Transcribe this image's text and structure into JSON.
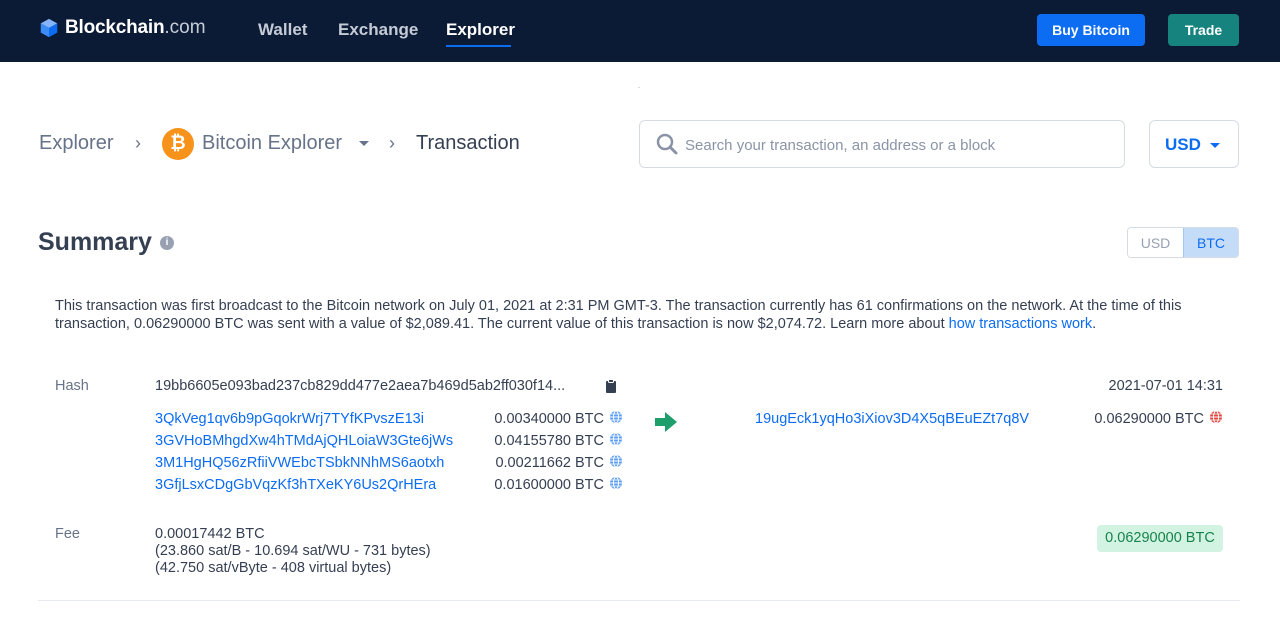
{
  "header": {
    "brand": "Blockchain",
    "brand_domain": ".com",
    "nav": {
      "wallet": "Wallet",
      "exchange": "Exchange",
      "explorer": "Explorer"
    },
    "buy_label": "Buy Bitcoin",
    "trade_label": "Trade"
  },
  "breadcrumb": {
    "root": "Explorer",
    "coin_symbol": "₿",
    "coin": "Bitcoin Explorer",
    "current": "Transaction",
    "separator": "›"
  },
  "search": {
    "placeholder": "Search your transaction, an address or a block"
  },
  "currency": {
    "selected": "USD"
  },
  "summary": {
    "title": "Summary",
    "info_icon": "i",
    "toggle": {
      "usd": "USD",
      "btc": "BTC",
      "active": "BTC"
    },
    "description": "This transaction was first broadcast to the Bitcoin network on July 01, 2021 at 2:31 PM GMT-3.  The transaction currently has 61 confirmations on the network.  At the time of this transaction, 0.06290000 BTC was sent with a value of $2,089.41. The current value of this transaction is now $2,074.72.  Learn more about ",
    "learn_more_link": "how transactions work",
    "period": "."
  },
  "transaction": {
    "hash_label": "Hash",
    "hash": "19bb6605e093bad237cb829dd477e2aea7b469d5ab2ff030f14...",
    "date": "2021-07-01 14:31",
    "inputs": [
      {
        "address": "3QkVeg1qv6b9pGqokrWrj7TYfKPvszE13i",
        "amount": "0.00340000 BTC"
      },
      {
        "address": "3GVHoBMhgdXw4hTMdAjQHLoiaW3Gte6jWs",
        "amount": "0.04155780 BTC"
      },
      {
        "address": "3M1HgHQ56zRfiiVWEbcTSbkNNhMS6aotxh",
        "amount": "0.00211662 BTC"
      },
      {
        "address": "3GfjLsxCDgGbVqzKf3hTXeKY6Us2QrHEra",
        "amount": "0.01600000 BTC"
      }
    ],
    "output": {
      "address": "19ugEck1yqHo3iXiov3D4X5qBEuEZt7q8V",
      "amount": "0.06290000 BTC"
    },
    "fee_label": "Fee",
    "fee": "0.00017442 BTC",
    "fee_detail_1": "(23.860 sat/B - 10.694 sat/WU - 731 bytes)",
    "fee_detail_2": "(42.750 sat/vByte - 408 virtual bytes)",
    "total": "0.06290000 BTC"
  },
  "icons": {
    "logo": "blockchain-cube-icon",
    "search": "search-icon",
    "copy": "clipboard-icon",
    "globe": "globe-icon",
    "arrow": "arrow-right-icon"
  },
  "colors": {
    "header_bg": "#0c1b35",
    "primary": "#0c6cf2",
    "trade": "#16837f",
    "bitcoin": "#f7931a",
    "success_bg": "#d2f3e1",
    "success_text": "#16834d"
  }
}
